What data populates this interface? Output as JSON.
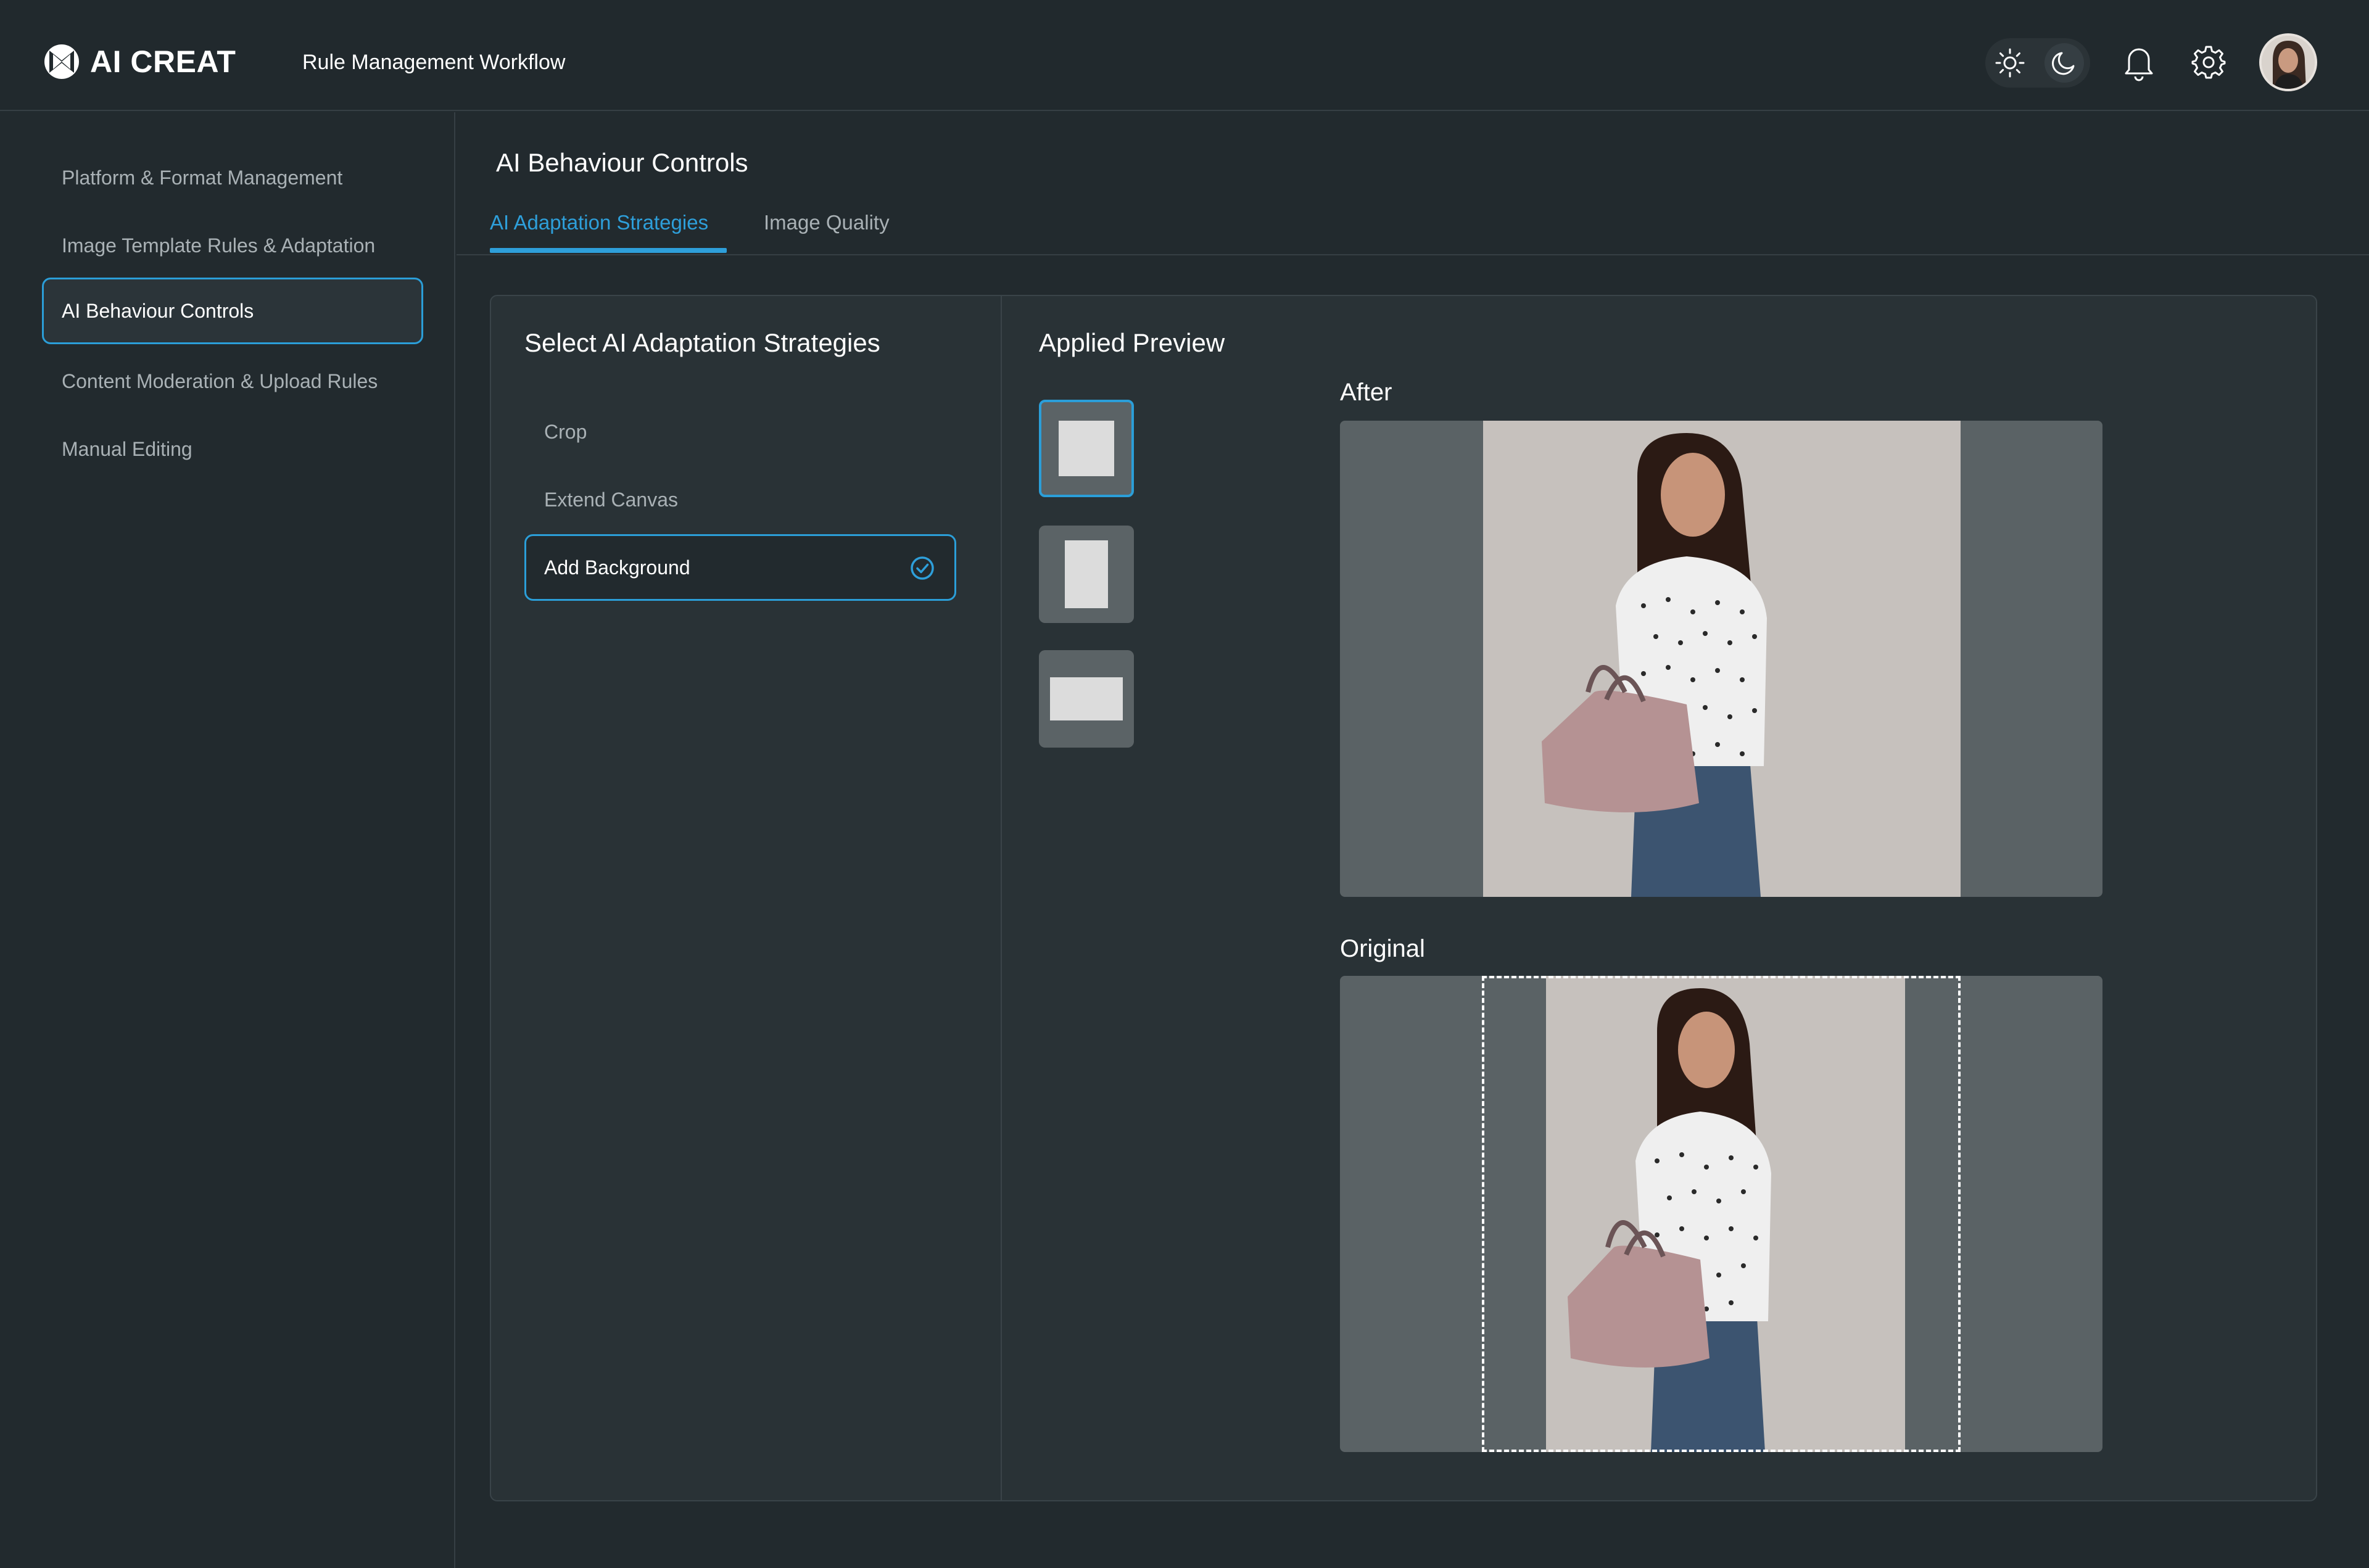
{
  "header": {
    "logo_text": "AI CREAT",
    "title": "Rule Management Workflow",
    "icons": [
      "logo-icon",
      "sun-icon",
      "moon-icon",
      "bell-icon",
      "gear-icon",
      "avatar"
    ]
  },
  "sidebar": {
    "items": [
      {
        "label": "Platform & Format Management",
        "active": false
      },
      {
        "label": "Image Template Rules & Adaptation",
        "active": false
      },
      {
        "label": "AI Behaviour Controls",
        "active": true
      },
      {
        "label": "Content Moderation & Upload Rules",
        "active": false
      },
      {
        "label": "Manual Editing",
        "active": false
      }
    ]
  },
  "main": {
    "title": "AI Behaviour Controls",
    "tabs": [
      {
        "label": "AI Adaptation Strategies",
        "active": true
      },
      {
        "label": "Image Quality",
        "active": false
      }
    ]
  },
  "strategies": {
    "heading": "Select AI Adaptation Strategies",
    "items": [
      {
        "label": "Crop",
        "selected": false
      },
      {
        "label": "Extend Canvas",
        "selected": false
      },
      {
        "label": "Add Background",
        "selected": true
      }
    ]
  },
  "preview": {
    "heading": "Applied Preview",
    "aspect_options": [
      {
        "name": "square",
        "selected": true
      },
      {
        "name": "portrait",
        "selected": false
      },
      {
        "name": "landscape",
        "selected": false
      }
    ],
    "after_label": "After",
    "original_label": "Original"
  },
  "colors": {
    "accent": "#2e9fda",
    "background": "#222a2e",
    "card": "#293236",
    "preview_bg": "#5a6265"
  }
}
